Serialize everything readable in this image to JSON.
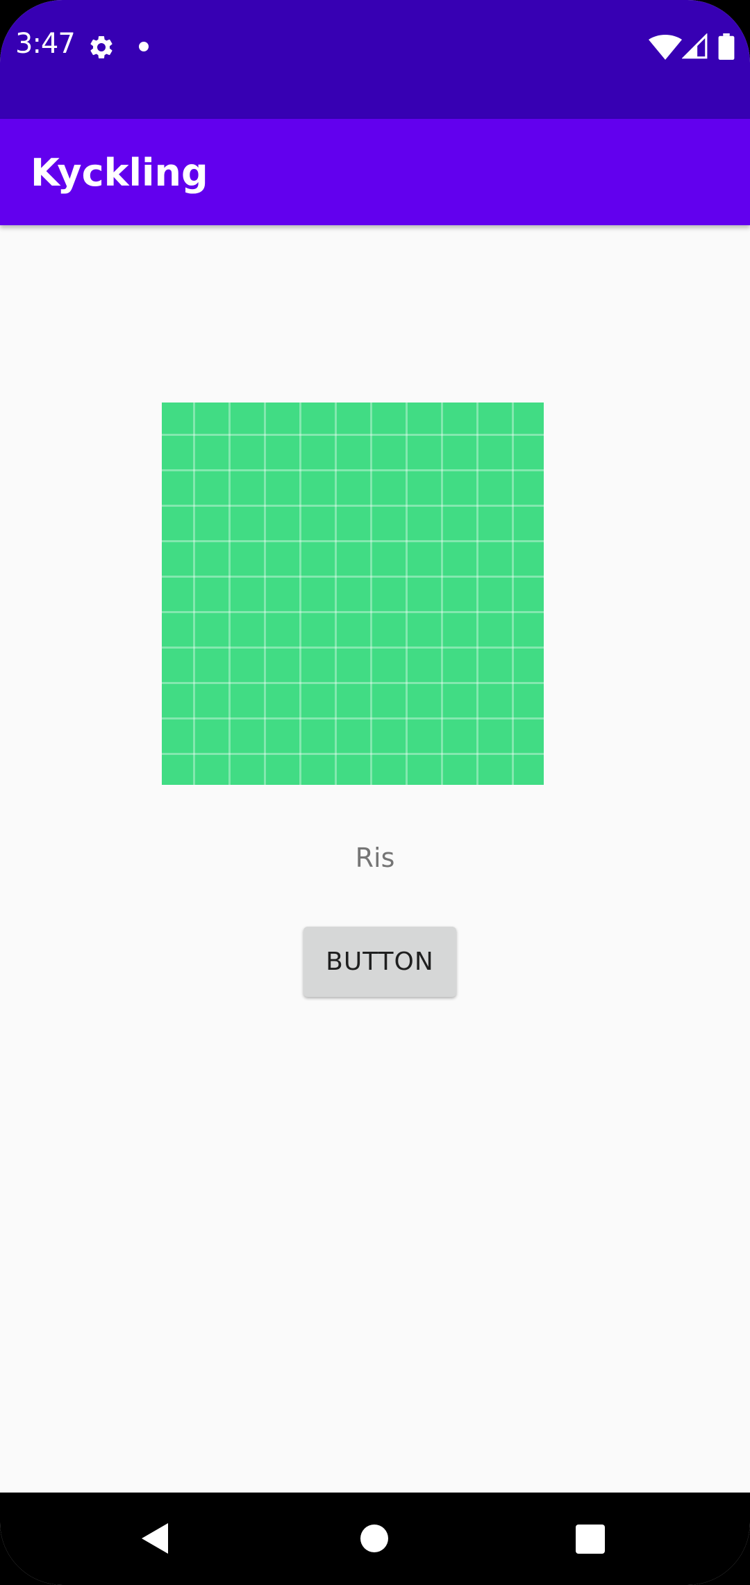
{
  "status_bar": {
    "time": "3:47",
    "icons": [
      "gear-icon",
      "notification-dot-icon",
      "wifi-icon",
      "signal-icon",
      "battery-icon"
    ],
    "background_color": "#3700b3"
  },
  "app_bar": {
    "title": "Kyckling",
    "background_color": "#6200ee"
  },
  "content": {
    "image_color": "#41dc84",
    "label": "Ris",
    "button_label": "BUTTON"
  },
  "nav_bar": {
    "icons": [
      "back-icon",
      "home-icon",
      "recents-icon"
    ]
  }
}
